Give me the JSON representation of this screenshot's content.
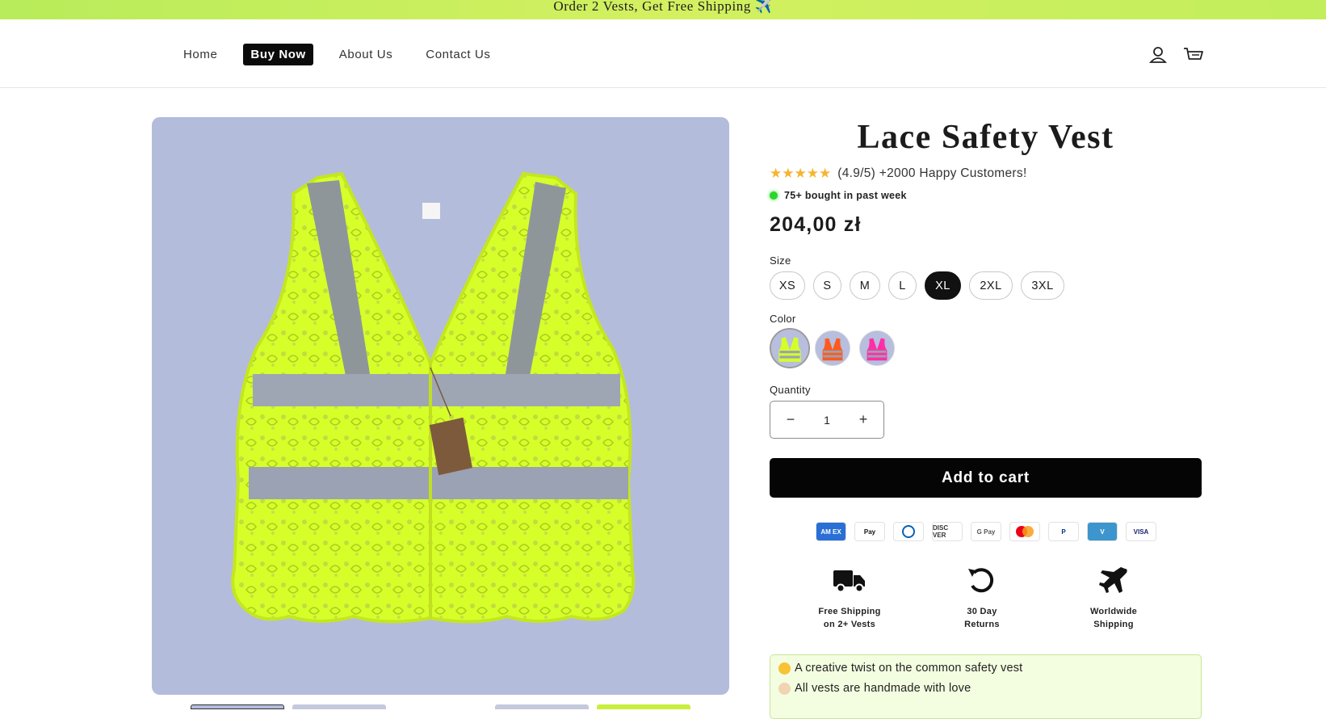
{
  "announcement": {
    "text": "Order 2 Vests, Get Free Shipping ✈️"
  },
  "nav": {
    "items": [
      {
        "label": "Home",
        "active": false
      },
      {
        "label": "Buy Now",
        "active": true
      },
      {
        "label": "About Us",
        "active": false
      },
      {
        "label": "Contact Us",
        "active": false
      }
    ],
    "icons": [
      "account-icon",
      "cart-icon"
    ]
  },
  "product": {
    "title": "Lace Safety Vest",
    "rating_stars": 5,
    "rating_text": "(4.9/5) +2000 Happy Customers!",
    "bought_text": "75+ bought in past week",
    "price": "204,00 zł",
    "size_label": "Size",
    "sizes": [
      "XS",
      "S",
      "M",
      "L",
      "XL",
      "2XL",
      "3XL"
    ],
    "selected_size": "XL",
    "color_label": "Color",
    "colors": [
      {
        "name": "yellow",
        "hex": "#d6ff2a",
        "selected": true
      },
      {
        "name": "orange",
        "hex": "#ff5a1f",
        "selected": false
      },
      {
        "name": "pink",
        "hex": "#ff2fa8",
        "selected": false
      }
    ],
    "quantity_label": "Quantity",
    "quantity": "1",
    "add_to_cart": "Add to cart"
  },
  "payments": [
    {
      "name": "American Express",
      "label": "AM EX"
    },
    {
      "name": "Apple Pay",
      "label": "Pay"
    },
    {
      "name": "Diners Club",
      "label": ""
    },
    {
      "name": "Discover",
      "label": "DISC VER"
    },
    {
      "name": "Google Pay",
      "label": "G Pay"
    },
    {
      "name": "Mastercard",
      "label": ""
    },
    {
      "name": "PayPal",
      "label": "P"
    },
    {
      "name": "Venmo",
      "label": "V"
    },
    {
      "name": "Visa",
      "label": "VISA"
    }
  ],
  "features": [
    {
      "icon": "truck-icon",
      "line1": "Free Shipping",
      "line2": "on 2+ Vests"
    },
    {
      "icon": "return-icon",
      "line1": "30 Day",
      "line2": "Returns"
    },
    {
      "icon": "airplane-icon",
      "line1": "Worldwide",
      "line2": "Shipping"
    }
  ],
  "highlights": [
    {
      "icon": "heart-eyes-emoji",
      "text": "A creative twist on the common safety vest"
    },
    {
      "icon": "hands-emoji",
      "text": "All vests are handmade with love"
    }
  ],
  "colors": {
    "accent": "#050505",
    "announcement_bg": "#c8ef5c",
    "image_bg": "#b4bcdc",
    "vest": "#d6ff2a",
    "reflective": "#8f969a",
    "star": "#f5b431",
    "info_bg": "#f3fde0"
  }
}
